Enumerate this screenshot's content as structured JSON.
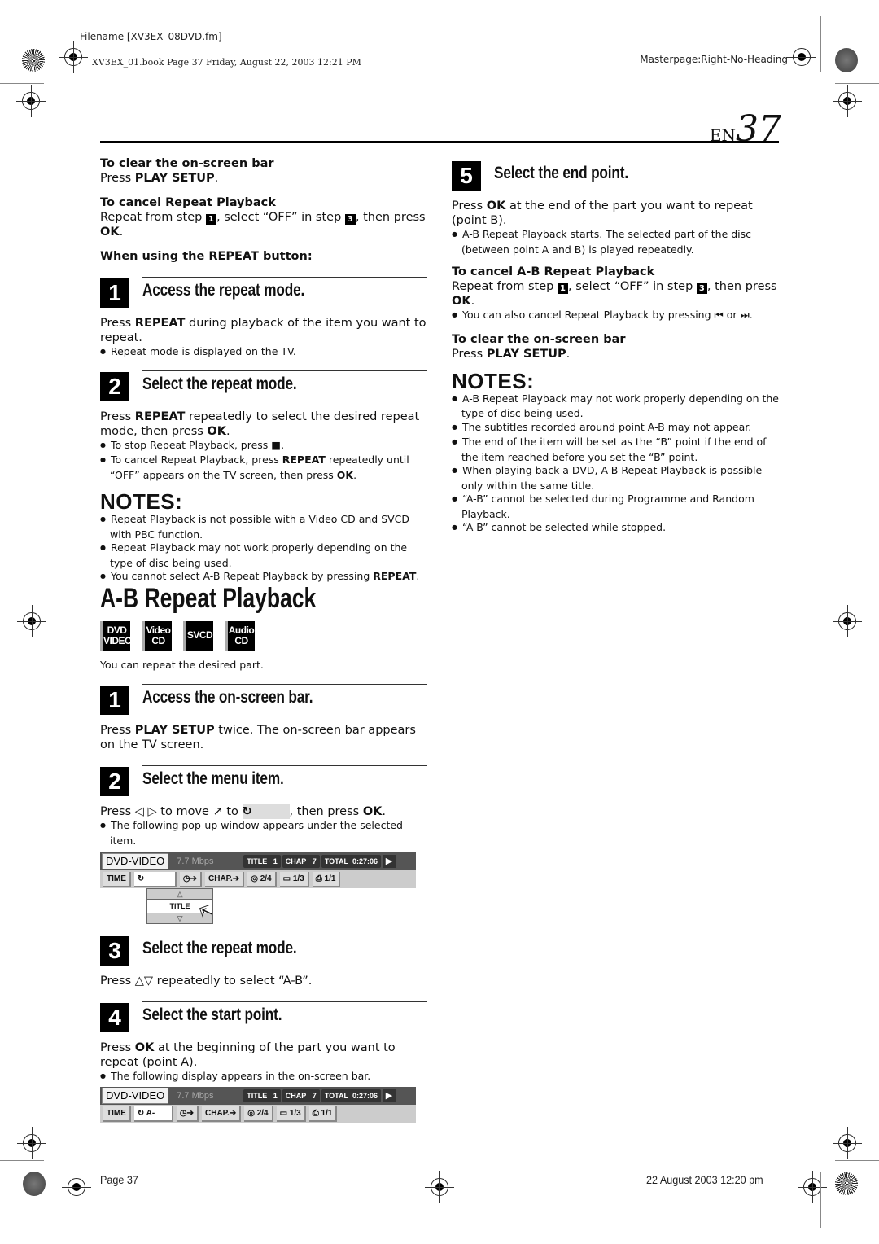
{
  "print_header": {
    "filename": "Filename [XV3EX_08DVD.fm]",
    "book_info": "XV3EX_01.book  Page 37  Friday, August 22, 2003  12:21 PM",
    "masterpage": "Masterpage:Right-No-Heading"
  },
  "page_number": {
    "lang": "EN",
    "number": "37"
  },
  "left_col": {
    "clear_bar": {
      "heading": "To clear the on-screen bar",
      "text_pre": "Press ",
      "key": "PLAY SETUP",
      "text_post": "."
    },
    "cancel_repeat": {
      "heading": "To cancel Repeat Playback",
      "text_a": "Repeat from step ",
      "step_a": "1",
      "text_b": ", select “OFF” in step ",
      "step_b": "3",
      "text_c": ", then press ",
      "key": "OK",
      "text_d": "."
    },
    "repeat_button_heading": "When using the REPEAT button:",
    "repeat_steps": [
      {
        "num": "1",
        "title": "Access the repeat mode.",
        "text_pre": "Press ",
        "key": "REPEAT",
        "text_post": " during playback of the item you want to repeat.",
        "bullets": [
          "Repeat mode is displayed on the TV."
        ]
      },
      {
        "num": "2",
        "title": "Select the repeat mode.",
        "text_pre": "Press ",
        "key": "REPEAT",
        "text_mid": " repeatedly to select the desired repeat mode, then press ",
        "key2": "OK",
        "text_post": ".",
        "bullet1": "To stop Repeat Playback, press ■.",
        "bullet2_pre": "To cancel Repeat Playback, press ",
        "bullet2_key": "REPEAT",
        "bullet2_mid": " repeatedly until “OFF” appears on the TV screen, then press ",
        "bullet2_key2": "OK",
        "bullet2_post": "."
      }
    ],
    "notes": {
      "title": "NOTES:",
      "items": [
        "Repeat Playback is not possible with a Video CD and SVCD with PBC function.",
        "Repeat Playback may not work properly depending on the type of disc being used."
      ],
      "item3_pre": "You cannot select A-B Repeat Playback by pressing ",
      "item3_key": "REPEAT",
      "item3_post": "."
    },
    "ab_title": "A-B Repeat Playback",
    "disc_badges": [
      {
        "line1": "DVD",
        "line2": "VIDEO"
      },
      {
        "line1": "Video",
        "line2": "CD"
      },
      {
        "line1": "SVCD",
        "line2": ""
      },
      {
        "line1": "Audio",
        "line2": "CD"
      }
    ],
    "ab_intro": "You can repeat the desired part.",
    "ab_steps": {
      "s1": {
        "num": "1",
        "title": "Access the on-screen bar.",
        "text_pre": "Press ",
        "key": "PLAY SETUP",
        "text_post": " twice. The on-screen bar appears on the TV screen."
      },
      "s2": {
        "num": "2",
        "title": "Select the menu item.",
        "text_a": "Press ◁ ▷ to move ↗ to ",
        "icon": "↻",
        "text_b": ", then press ",
        "key": "OK",
        "text_c": ".",
        "bullet": "The following pop-up window appears under the selected item."
      },
      "s3": {
        "num": "3",
        "title": "Select the repeat mode.",
        "text": "Press △▽ repeatedly to select “A-B”."
      },
      "s4": {
        "num": "4",
        "title": "Select the start point.",
        "text_pre": "Press ",
        "key": "OK",
        "text_post": " at the beginning of the part you want to repeat (point A).",
        "bullet": "The following display appears in the on-screen bar."
      }
    }
  },
  "osd_bar_1": {
    "disc": "DVD-VIDEO",
    "bitrate": "7.7 Mbps",
    "title_label": "TITLE",
    "title_val": "1",
    "chap_label": "CHAP",
    "chap_val": "7",
    "total_label": "TOTAL",
    "total_val": "0:27:06",
    "play": "▶",
    "buttons": [
      "TIME",
      "↻",
      "◷➔",
      "CHAP.➔",
      "◎ 2/4",
      "▭ 1/3",
      "⎙ 1/1"
    ],
    "popup": {
      "up": "△",
      "value": "TITLE",
      "down": "▽"
    }
  },
  "osd_bar_2": {
    "disc": "DVD-VIDEO",
    "bitrate": "7.7 Mbps",
    "title_label": "TITLE",
    "title_val": "1",
    "chap_label": "CHAP",
    "chap_val": "7",
    "total_label": "TOTAL",
    "total_val": "0:27:06",
    "play": "▶",
    "buttons": [
      "TIME",
      "↻ A-",
      "◷➔",
      "CHAP.➔",
      "◎ 2/4",
      "▭ 1/3",
      "⎙ 1/1"
    ]
  },
  "right_col": {
    "s5": {
      "num": "5",
      "title": "Select the end point.",
      "text_pre": "Press ",
      "key": "OK",
      "text_post": " at the end of the part you want to repeat (point B).",
      "bullet": "A-B Repeat Playback starts. The selected part of the disc (between point A and B) is played repeatedly."
    },
    "cancel_ab": {
      "heading": "To cancel A-B Repeat Playback",
      "text_a": "Repeat from step ",
      "step_a": "1",
      "text_b": ", select “OFF” in step ",
      "step_b": "3",
      "text_c": ", then press ",
      "key": "OK",
      "text_d": ".",
      "bullet": "You can also cancel Repeat Playback by pressing ⏮ or ⏭."
    },
    "clear_bar": {
      "heading": "To clear the on-screen bar",
      "text_pre": "Press ",
      "key": "PLAY SETUP",
      "text_post": "."
    },
    "notes": {
      "title": "NOTES:",
      "items": [
        "A-B Repeat Playback may not work properly depending on the type of disc being used.",
        "The subtitles recorded around point A-B may not appear.",
        "The end of the item will be set as the “B” point if the end of the item reached before you set the “B” point.",
        "When playing back a DVD, A-B Repeat Playback is possible only within the same title.",
        "“A-B” cannot be selected during Programme and Random Playback.",
        "“A-B” cannot be selected while stopped."
      ]
    }
  },
  "footer": {
    "page": "Page 37",
    "date": "22 August 2003 12:20 pm"
  }
}
